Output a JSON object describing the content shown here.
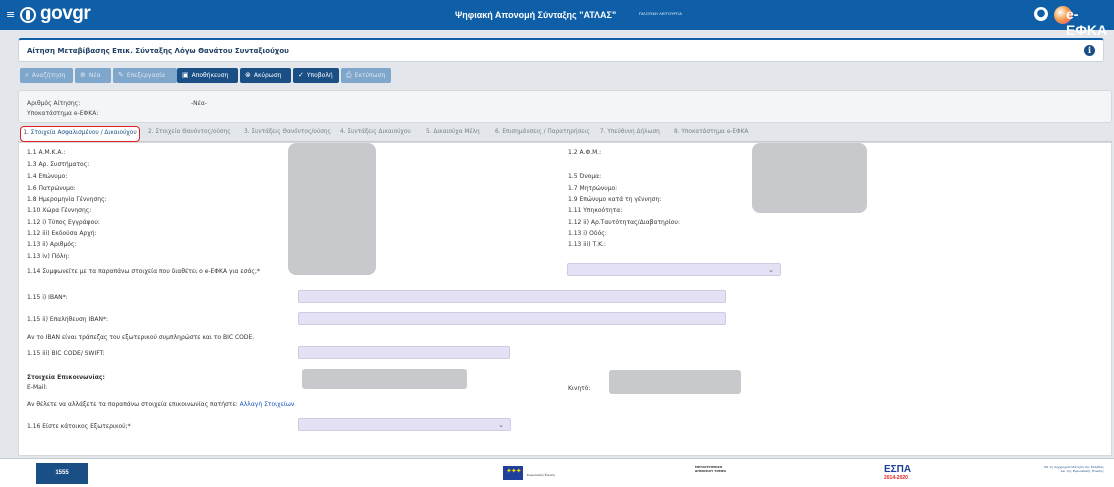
{
  "header": {
    "logo_text": "govgr",
    "title": "Ψηφιακή Απονομή Σύνταξης \"ΑΤΛΑΣ\"",
    "environment": "ΠΙΛΟΤΙΚΗ ΛΕΙΤΟΥΡΓΙΑ",
    "brand_text": "e-ΕΦΚΑ",
    "brand_color": "#0e5fa8"
  },
  "page": {
    "title": "Αίτηση Μεταβίβασης Επικ. Σύνταξης Λόγω Θανάτου Συνταξιούχου"
  },
  "toolbar": {
    "search": "Αναζήτηση",
    "new": "Νέα",
    "edit": "Επεξεργασία",
    "save": "Αποθήκευση",
    "cancel": "Ακύρωση",
    "submit": "Υποβολή",
    "print": "Εκτύπωση"
  },
  "application": {
    "number_label": "Αριθμός Αίτησης:",
    "number_value": "-Νέα-",
    "branch_label": "Υποκατάστημα e-ΕΦΚΑ:"
  },
  "tabs": [
    {
      "label": "1. Στοιχεία Ασφαλισμένου / Δικαιούχου"
    },
    {
      "label": "2. Στοιχεία Θανόντος/ούσης"
    },
    {
      "label": "3. Συντάξεις Θανόντος/ούσης"
    },
    {
      "label": "4. Συντάξεις Δικαιούχου"
    },
    {
      "label": "5. Δικαιούχα Μέλη"
    },
    {
      "label": "6. Επισημάνσεις / Παρατηρήσεις"
    },
    {
      "label": "7. Υπεύθυνη Δήλωση"
    },
    {
      "label": "8. Υποκατάστημα e-ΕΦΚΑ"
    }
  ],
  "form": {
    "left_labels": [
      "1.1 Α.Μ.Κ.Α.:",
      "1.3 Αρ. Συστήματος:",
      "1.4 Επώνυμο:",
      "1.6 Πατρώνυμο:",
      "1.8 Ημερομηνία Γέννησης:",
      "1.10 Χώρα Γέννησης:",
      "1.12 i) Τύπος Εγγράφου:",
      "1.12 iii) Εκδούσα Αρχή:",
      "1.13 ii) Αριθμός:",
      "1.13 iv) Πόλη:"
    ],
    "right_labels": [
      "1.2 Α.Φ.Μ.:",
      "",
      "1.5 Όνομα:",
      "1.7 Μητρώνυμο:",
      "1.9 Επώνυμο κατά τη γέννηση:",
      "1.11 Υπηκοότητα:",
      "1.12 ii) Αρ.Ταυτότητας/Διαβατηρίου:",
      "1.13 i) Οδός:",
      "1.13 iii) Τ.Κ.:"
    ],
    "agree_label": "1.14 Συμφωνείτε με τα παραπάνω στοιχεία που διαθέτει ο e-ΕΦΚΑ για εσάς;*",
    "iban_label": "1.15 i) IBAN*:",
    "iban_confirm_label": "1.15 ii) Επαλήθευση IBAN*:",
    "foreign_bank_note": "Αν το IBAN είναι τράπεζας του εξωτερικού συμπληρώστε και το BIC CODE.",
    "bic_label": "1.15 iii) BIC CODE/ SWIFT:",
    "contact_heading": "Στοιχεία Επικοινωνίας:",
    "email_label": "E-Mail:",
    "mobile_label": "Κινητό:",
    "change_contact_text": "Αν θέλετε να αλλάξετε τα παραπάνω στοιχεία επικοινωνίας πατήστε:",
    "change_contact_link": "Αλλαγή Στοιχείων",
    "abroad_label": "1.16 Είστε κάτοικος Εξωτερικού;*"
  },
  "footer": {
    "helpline": "1555",
    "eu_text": "Ευρωπαϊκή Ένωση",
    "middle_text": "ΜΕΤΑΡΡΥΘΜΙΣΗ ΔΗΜΟΣΙΟΥ ΤΟΜΕΑ",
    "espa_text": "ΕΣΠΑ",
    "espa_years": "2014-2020",
    "right_text": "Με τη συγχρηματοδότηση της Ελλάδας και της Ευρωπαϊκής Ένωσης"
  },
  "icons": [
    "hamburger-icon",
    "search-icon",
    "plus-icon",
    "edit-icon",
    "save-icon",
    "cancel-icon",
    "check-icon",
    "print-icon",
    "user-icon",
    "info-icon",
    "chevron-down-icon"
  ]
}
